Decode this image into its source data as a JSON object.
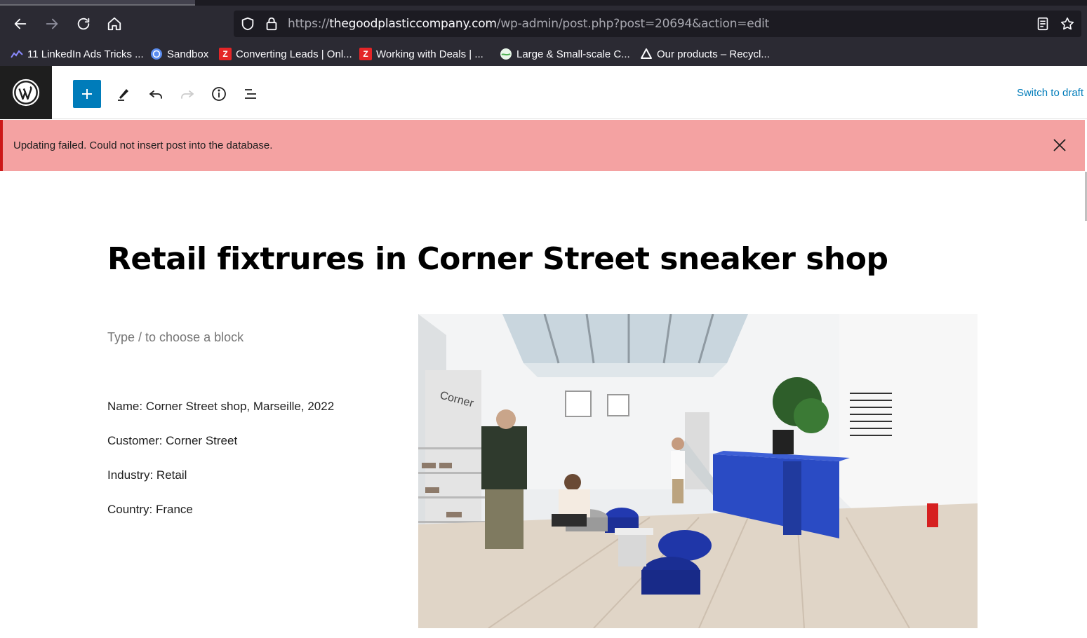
{
  "browser": {
    "url_prefix": "https://",
    "url_host": "thegoodplasticcompany.com",
    "url_path": "/wp-admin/post.php?post=20694&action=edit",
    "bookmarks": [
      {
        "label": "11 LinkedIn Ads Tricks ...",
        "icon": "linkedin-ads-favicon",
        "color": "#7c7cff"
      },
      {
        "label": "Sandbox",
        "icon": "sandbox-favicon",
        "color": "#5b8def"
      },
      {
        "label": "Converting Leads | Onl...",
        "icon": "zoho-favicon",
        "color": "#e42527",
        "glyph": "Z"
      },
      {
        "label": "Working with Deals | ...",
        "icon": "zoho-favicon",
        "color": "#e42527",
        "glyph": "Z"
      },
      {
        "label": "Large & Small-scale C...",
        "icon": "globe-favicon",
        "color": "#4caf50"
      },
      {
        "label": "Our products – Recycl...",
        "icon": "recycle-favicon",
        "color": "#000000"
      }
    ]
  },
  "editor": {
    "switch_to_draft": "Switch to draft",
    "accent_color": "#007cba"
  },
  "notice": {
    "message": "Updating failed. Could not insert post into the database.",
    "color": "#f4a2a2"
  },
  "post": {
    "title": "Retail fixtrures in Corner Street sneaker shop",
    "block_placeholder": "Type / to choose a block",
    "details": [
      "Name: Corner Street shop, Marseille, 2022",
      "Customer: Corner Street",
      "Industry: Retail",
      "Country: France"
    ],
    "image_sign_text": "Corner"
  }
}
